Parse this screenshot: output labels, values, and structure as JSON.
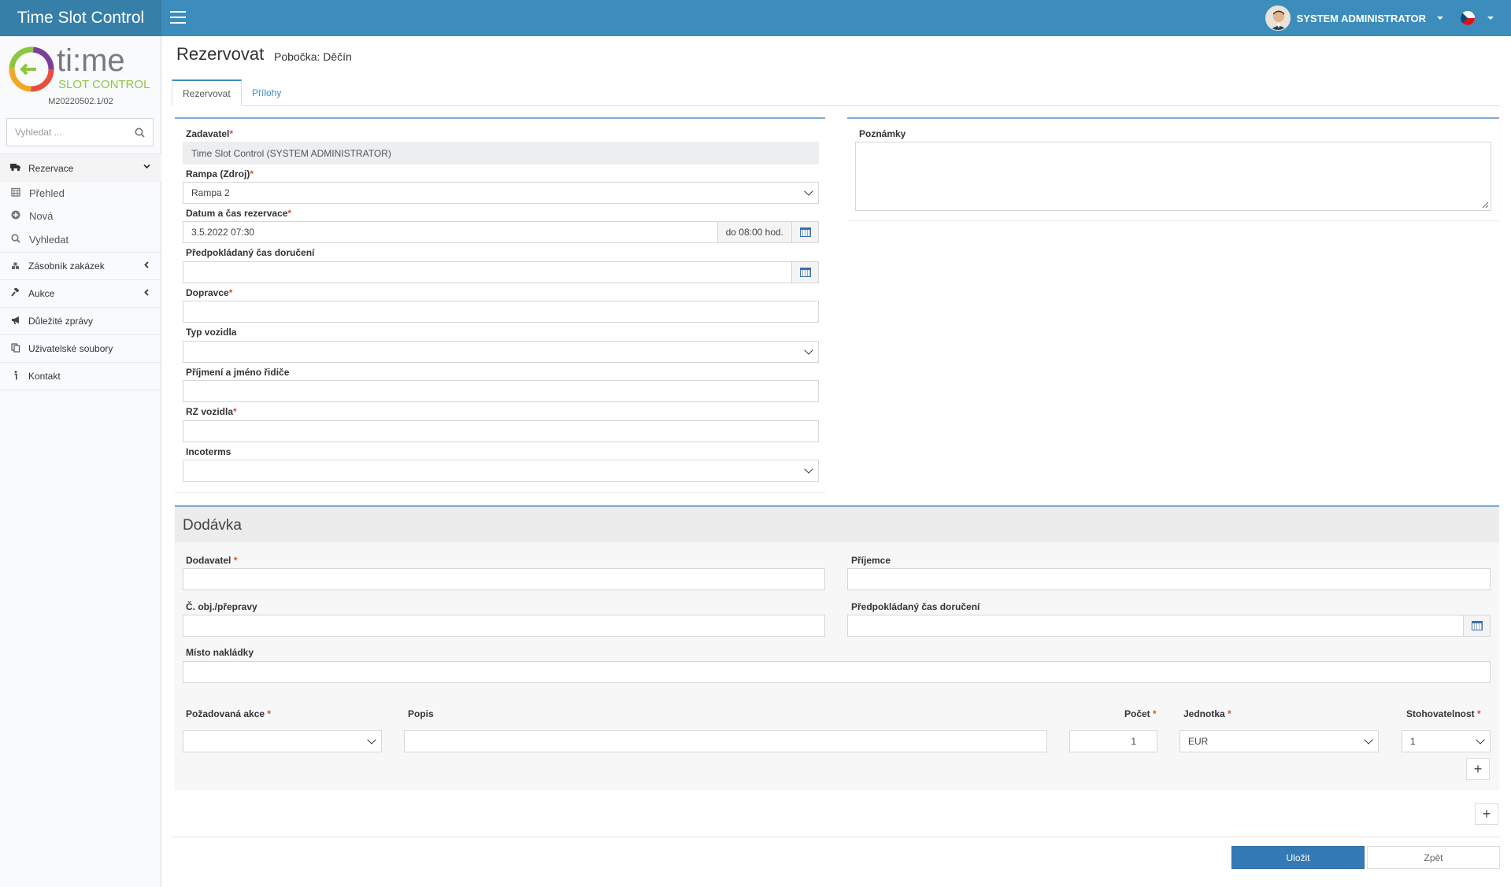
{
  "app": {
    "title": "Time Slot Control",
    "version": "M20220502.1/02"
  },
  "user": {
    "name": "SYSTEM ADMINISTRATOR"
  },
  "logo": {
    "top": "ti:me",
    "bottom": "SLOT CONTROL"
  },
  "search": {
    "placeholder": "Vyhledat ..."
  },
  "sidebar": {
    "rezervace": "Rezervace",
    "sub": [
      "Přehled",
      "Nová",
      "Vyhledat"
    ],
    "items": [
      "Zásobník zakázek",
      "Aukce",
      "Důležité zprávy",
      "Uživatelské soubory",
      "Kontakt"
    ]
  },
  "page": {
    "title": "Rezervovat",
    "subtitle": "Pobočka: Děčín"
  },
  "tabs": [
    "Rezervovat",
    "Přílohy"
  ],
  "form": {
    "zadavatel_label": "Zadavatel",
    "zadavatel_value": "Time Slot Control (SYSTEM ADMINISTRATOR)",
    "rampa_label": "Rampa (Zdroj)",
    "rampa_value": "Rampa 2",
    "datum_label": "Datum a čas rezervace",
    "datum_value": "3.5.2022 07:30",
    "datum_to": "do 08:00 hod.",
    "predpokladany_label": "Předpokládaný čas doručení",
    "dopravce_label": "Dopravce",
    "typ_label": "Typ vozidla",
    "ridic_label": "Příjmení a jméno řidiče",
    "rz_label": "RZ vozidla",
    "incoterms_label": "Incoterms",
    "poznamky_label": "Poznámky"
  },
  "dodavka": {
    "title": "Dodávka",
    "dodavatel_label": "Dodavatel",
    "prijemce_label": "Příjemce",
    "obj_label": "Č. obj./přepravy",
    "predpokladany_label": "Předpokládaný čas doručení",
    "misto_label": "Místo nakládky",
    "akce_label": "Požadovaná akce",
    "popis_label": "Popis",
    "pocet_label": "Počet",
    "pocet_value": "1",
    "jednotka_label": "Jednotka",
    "jednotka_value": "EUR",
    "stoh_label": "Stohovatelnost",
    "stoh_value": "1"
  },
  "buttons": {
    "save": "Uložit",
    "back": "Zpět",
    "plus": "+"
  },
  "colors": {
    "header": "#3c8dbc",
    "brand": "#367fa9",
    "primary": "#337ab7",
    "required": "#dd4b39"
  }
}
